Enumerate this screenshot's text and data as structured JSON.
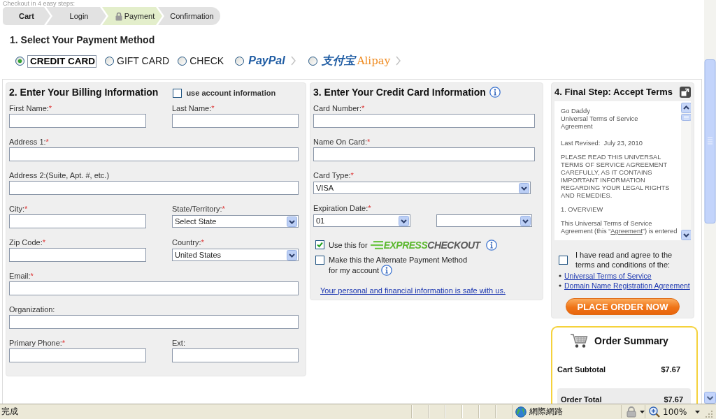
{
  "header": {
    "intro": "Checkout in 4 easy steps:",
    "steps": [
      {
        "label": "Cart",
        "selected": false,
        "done": true,
        "locked": false
      },
      {
        "label": "Login",
        "selected": false,
        "done": false,
        "locked": false
      },
      {
        "label": "Payment",
        "selected": true,
        "done": false,
        "locked": true
      },
      {
        "label": "Confirmation",
        "selected": false,
        "done": false,
        "locked": false
      }
    ]
  },
  "payment_method": {
    "title": "1. Select Your Payment Method",
    "options": [
      {
        "kind": "text",
        "label": "CREDIT CARD",
        "selected": true
      },
      {
        "kind": "text",
        "label": "GIFT CARD",
        "selected": false
      },
      {
        "kind": "text",
        "label": "CHECK",
        "selected": false
      },
      {
        "kind": "logo",
        "logo": [
          "PayPal"
        ],
        "selected": false
      },
      {
        "kind": "logo",
        "logo": [
          "支付宝",
          "Alipay"
        ],
        "selected": false
      }
    ]
  },
  "billing": {
    "title": "2. Enter Your Billing Information",
    "use_account": {
      "label": "use account information",
      "checked": false
    },
    "rows": [
      [
        {
          "kind": "input",
          "label": "First Name:",
          "required_mark": "*"
        },
        {
          "kind": "input",
          "label": "Last Name:",
          "required_mark": "*"
        }
      ],
      [
        {
          "kind": "input",
          "label": "Address 1:",
          "required_mark": "*"
        }
      ],
      [
        {
          "kind": "input",
          "label": "Address 2:(Suite, Apt. #, etc.)"
        }
      ],
      [
        {
          "kind": "input",
          "label": "City:",
          "required_mark": "*"
        },
        {
          "kind": "select",
          "label": "State/Territory:",
          "required_mark": "*",
          "value": "Select State"
        }
      ],
      [
        {
          "kind": "input",
          "label": "Zip Code:",
          "required_mark": "*"
        },
        {
          "kind": "select",
          "label": "Country:",
          "required_mark": "*",
          "value": "United States"
        }
      ],
      [
        {
          "kind": "input",
          "label": "Email:",
          "required_mark": "*"
        }
      ],
      [
        {
          "kind": "input",
          "label": "Organization:"
        }
      ],
      [
        {
          "kind": "input",
          "label": "Primary Phone:",
          "required_mark": "*"
        },
        {
          "kind": "input",
          "label": "Ext:"
        }
      ]
    ]
  },
  "credit_card": {
    "title": "3. Enter Your Credit Card Information",
    "fields": [
      {
        "kind": "input",
        "label": "Card Number:",
        "required_mark": "*"
      },
      {
        "kind": "input",
        "label": "Name On Card:",
        "required_mark": "*"
      },
      {
        "kind": "select",
        "label": "Card Type:",
        "required_mark": "*",
        "value": "VISA"
      },
      {
        "kind": "expiry",
        "label": "Expiration Date:",
        "required_mark": "*",
        "month": "01"
      }
    ],
    "options": [
      {
        "kind": "express",
        "label": "Use this for",
        "logo": "**EXPRESS**CHECKOUT",
        "checked": true
      },
      {
        "kind": "plain",
        "label": "Make this the Alternate Payment Method for my account",
        "checked": false
      }
    ],
    "security_link": "Your personal and financial information is safe with us."
  },
  "terms": {
    "title": "4. Final Step: Accept Terms",
    "document": [
      {
        "kind": "lines",
        "lines": [
          "Go Daddy",
          "Universal Terms of Service Agreement"
        ]
      },
      {
        "kind": "text",
        "text": "Last Revised:  July 23, 2010"
      },
      {
        "kind": "text",
        "text": "PLEASE READ THIS UNIVERSAL TERMS OF SERVICE AGREEMENT CAREFULLY, AS IT CONTAINS IMPORTANT INFORMATION REGARDING YOUR LEGAL RIGHTS AND REMEDIES."
      },
      {
        "kind": "text",
        "text": "1. OVERVIEW"
      },
      {
        "kind": "link",
        "before": "This Universal Terms of Service Agreement (this “",
        "link": "Agreement",
        "after": "”) is entered"
      }
    ],
    "agree": {
      "label": "I have read and agree to the terms and conditions of the:",
      "checked": false
    },
    "links": [
      "Universal Terms of Service",
      "Domain Name Registration Agreement"
    ],
    "button": "PLACE ORDER NOW"
  },
  "summary": {
    "title": "Order Summary",
    "lines": [
      {
        "kind": "subtotal",
        "label": "Cart Subtotal",
        "amount": "$7.67"
      },
      {
        "kind": "total",
        "label": "Order Total",
        "amount": "$7.67"
      }
    ]
  },
  "status_bar": {
    "text": "完成",
    "zone": "網際網路",
    "zoom": "100%"
  }
}
